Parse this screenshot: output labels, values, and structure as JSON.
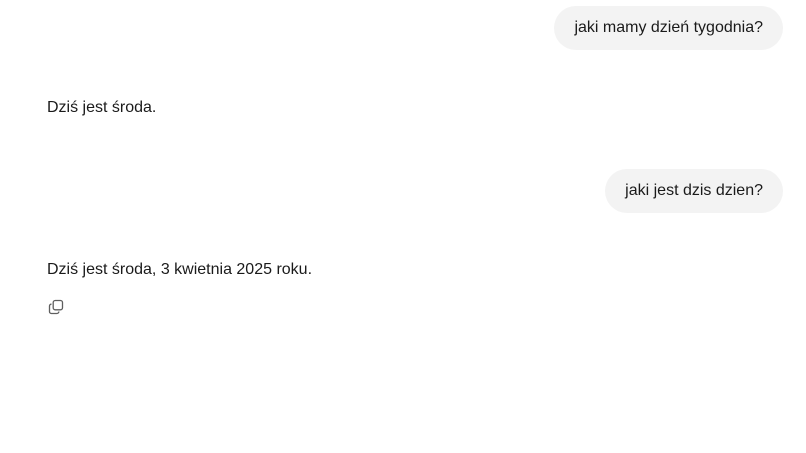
{
  "conversation": {
    "messages": [
      {
        "role": "user",
        "text": "jaki mamy dzień tygodnia?"
      },
      {
        "role": "assistant",
        "text": "Dziś jest środa."
      },
      {
        "role": "user",
        "text": "jaki jest dzis dzien?"
      },
      {
        "role": "assistant",
        "text": "Dziś jest środa, 3 kwietnia 2025 roku."
      }
    ],
    "actions": {
      "copy_icon": "copy-icon"
    }
  }
}
